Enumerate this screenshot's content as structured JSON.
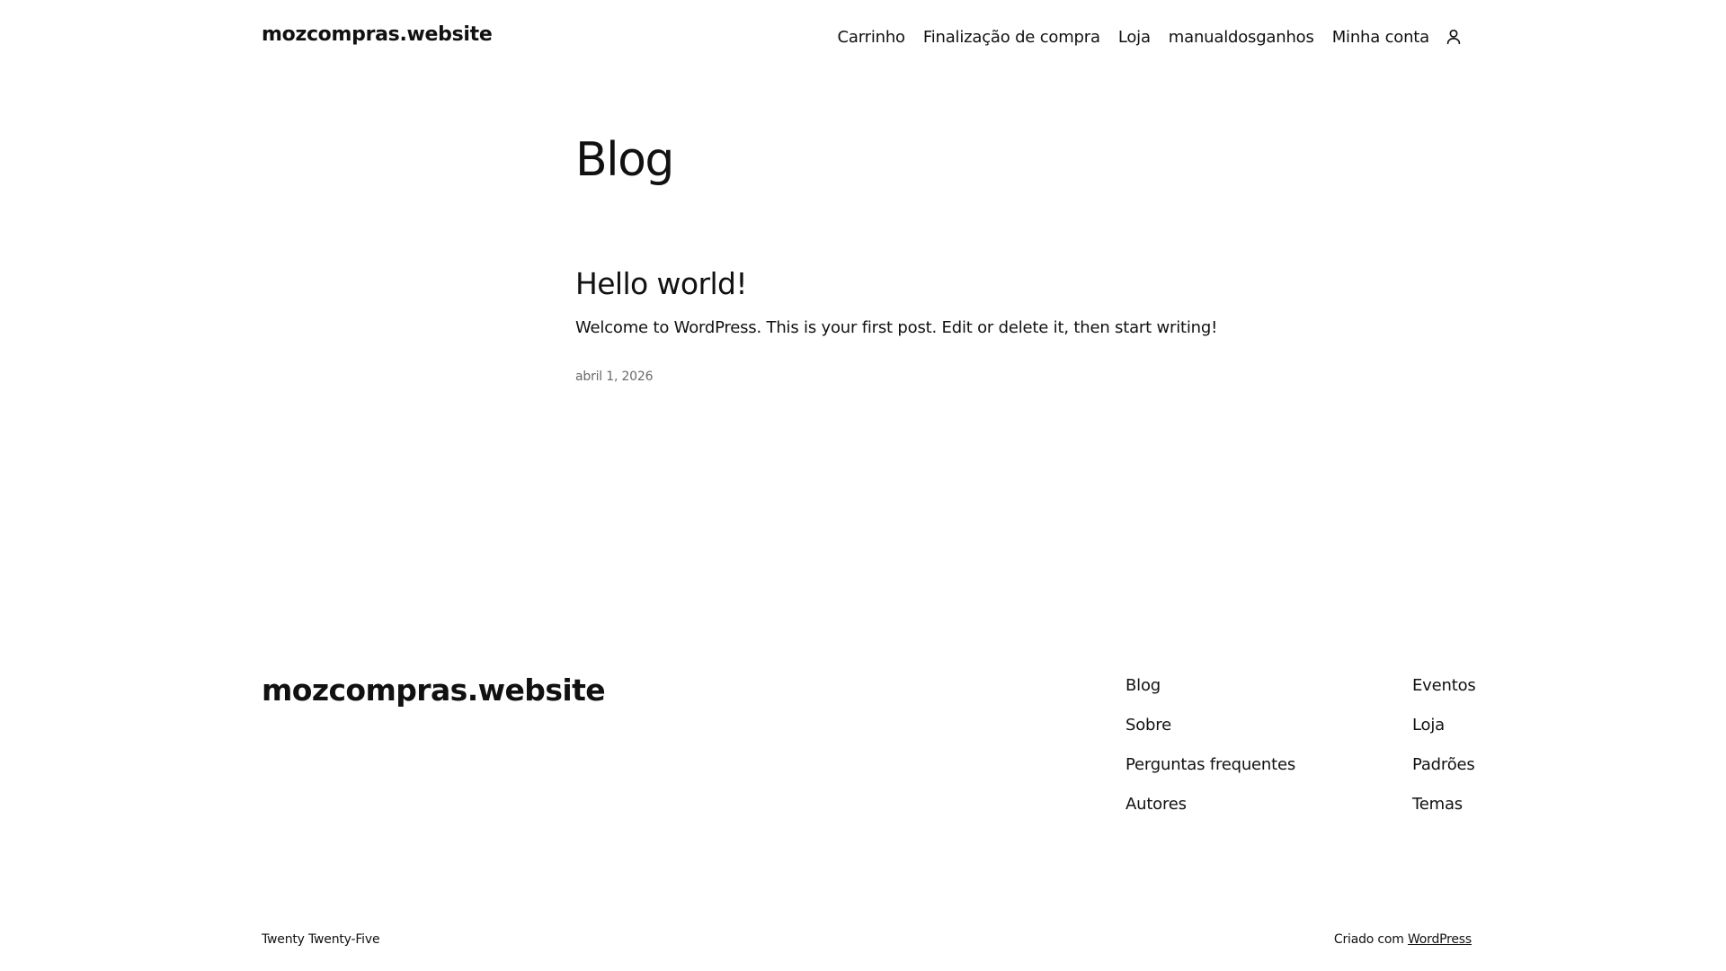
{
  "header": {
    "site_title": "mozcompras.website",
    "nav": [
      {
        "label": "Carrinho"
      },
      {
        "label": "Finalização de compra"
      },
      {
        "label": "Loja"
      },
      {
        "label": "manualdosganhos"
      },
      {
        "label": "Minha conta"
      }
    ],
    "account_icon": "user-icon"
  },
  "main": {
    "page_title": "Blog",
    "posts": [
      {
        "title": "Hello world!",
        "excerpt": "Welcome to WordPress. This is your first post. Edit or delete it, then start writing!",
        "date": "abril 1, 2026"
      }
    ]
  },
  "footer": {
    "site_title": "mozcompras.website",
    "col1": [
      {
        "label": "Blog"
      },
      {
        "label": "Sobre"
      },
      {
        "label": "Perguntas frequentes"
      },
      {
        "label": "Autores"
      }
    ],
    "col2": [
      {
        "label": "Eventos"
      },
      {
        "label": "Loja"
      },
      {
        "label": "Padrões"
      },
      {
        "label": "Temas"
      }
    ],
    "theme_credit": "Twenty Twenty-Five",
    "powered_prefix": "Criado com ",
    "powered_link": "WordPress"
  },
  "colors": {
    "text": "#111111",
    "muted": "#6a6a6a",
    "background": "#ffffff"
  }
}
